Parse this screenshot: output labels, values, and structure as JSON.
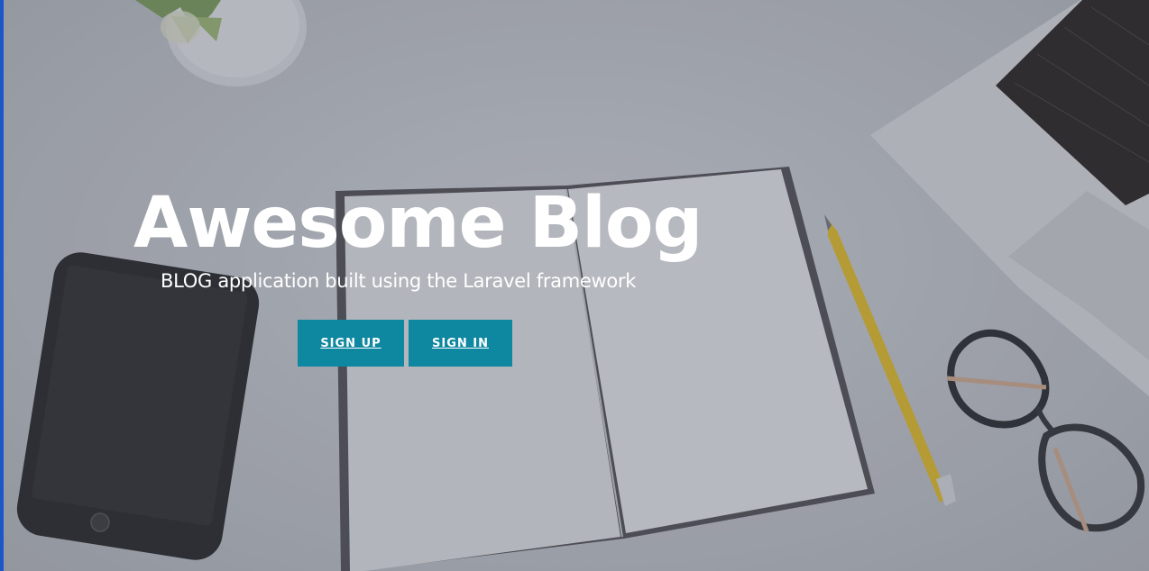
{
  "hero": {
    "title": "Awesome Blog",
    "subtitle": "BLOG application built using the Laravel framework",
    "background_image": "desk-workspace-photo"
  },
  "buttons": {
    "signup_label": "SIGN UP",
    "signin_label": "SIGN IN"
  },
  "colors": {
    "button_bg": "#0e87a1",
    "text": "#ffffff",
    "left_edge": "#1c56c9"
  }
}
